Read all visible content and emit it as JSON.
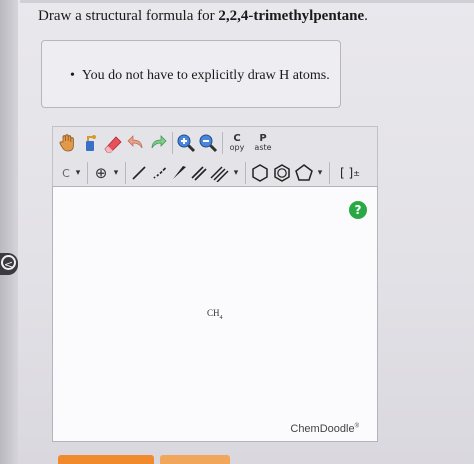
{
  "question": {
    "prefix": "Draw a structural formula for ",
    "compound": "2,2,4-trimethylpentane",
    "suffix": "."
  },
  "hint": {
    "bullet": "•",
    "text": "You do not have to explicitly draw H atoms."
  },
  "toolbar": {
    "copy_top": "C",
    "copy_bottom": "opy",
    "paste_top": "P",
    "paste_bottom": "aste",
    "atom_label": "C",
    "charge_symbol": "⊕",
    "dropdown_arrow": "▾",
    "brackets_label": "[ ]",
    "brackets_sup": "±"
  },
  "canvas": {
    "help_label": "?",
    "molecule": "CH",
    "molecule_sub": "4",
    "brand": "ChemDoodle",
    "brand_mark": "®"
  },
  "colors": {
    "help_green": "#2aa845",
    "orange_button": "#f08a2c",
    "pink_tool": "#e8505c"
  }
}
